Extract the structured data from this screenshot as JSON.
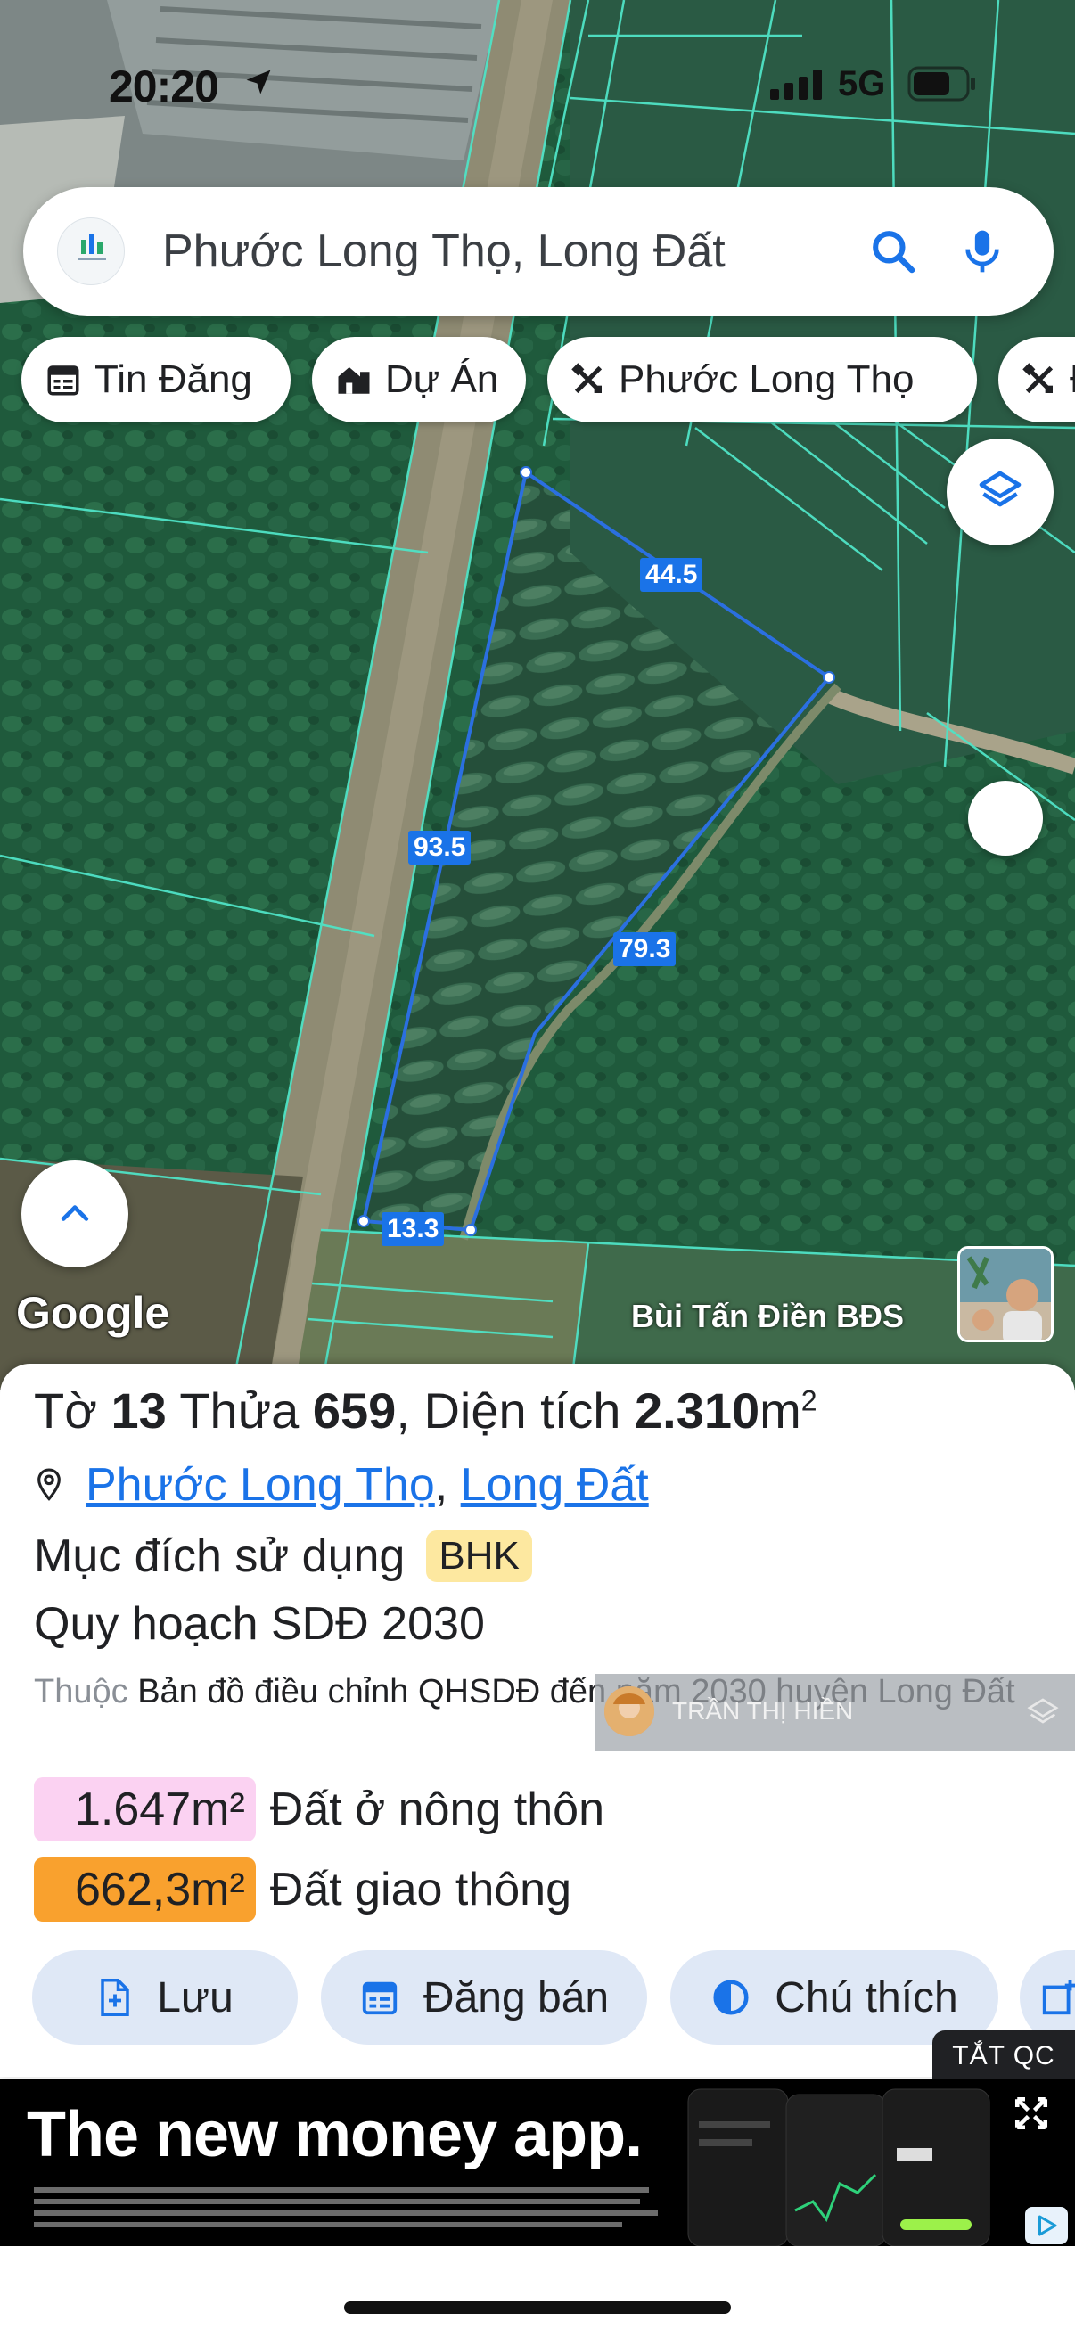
{
  "status_bar": {
    "time": "20:20",
    "network": "5G"
  },
  "search": {
    "value": "Phước Long Thọ, Long Đất"
  },
  "chips": [
    {
      "label": "Tin Đăng",
      "icon": "calendar-icon"
    },
    {
      "label": "Dự Án",
      "icon": "building-icon"
    },
    {
      "label": "Phước Long Thọ",
      "icon": "tools-icon"
    },
    {
      "label": "Đ",
      "icon": "tools-icon"
    }
  ],
  "map": {
    "measurements": {
      "top": "44.5",
      "left": "93.5",
      "right": "79.3",
      "bottom": "13.3"
    },
    "google_label": "Google",
    "watermark_name": "Bùi Tấn Điền BĐS"
  },
  "parcel": {
    "sheet_prefix": "Tờ",
    "sheet_number": "13",
    "plot_prefix": "Thửa",
    "plot_number": "659",
    "area_prefix": ", Diện tích",
    "area_value": "2.310",
    "area_unit": "m",
    "area_unit_sup": "2",
    "ward": "Phước Long Thọ",
    "district": "Long Đất",
    "purpose_label": "Mục đích sử dụng",
    "purpose_code": "BHK",
    "plan_title": "Quy hoạch SDĐ 2030",
    "source_prefix": "Thuộc",
    "source_text": "Bản đồ điều chỉnh QHSDĐ đến năm 2030 huyện Long Đất",
    "overlay_name": "TRẦN THỊ HIỀN",
    "zones": [
      {
        "area": "1.647m²",
        "label": "Đất ở nông thôn",
        "color": "#fbd2f2"
      },
      {
        "area": "662,3m²",
        "label": "Đất giao thông",
        "color": "#f9a12e"
      }
    ]
  },
  "actions": [
    {
      "label": "Lưu",
      "icon": "file-add-icon"
    },
    {
      "label": "Đăng bán",
      "icon": "calendar-icon"
    },
    {
      "label": "Chú thích",
      "icon": "contrast-icon"
    }
  ],
  "ad": {
    "close_label": "TẮT QC",
    "headline": "The new money app."
  },
  "colors": {
    "accent": "#1a73e8",
    "parcel_line": "#2b6fe0",
    "chip_bg": "#dfe8f6"
  }
}
